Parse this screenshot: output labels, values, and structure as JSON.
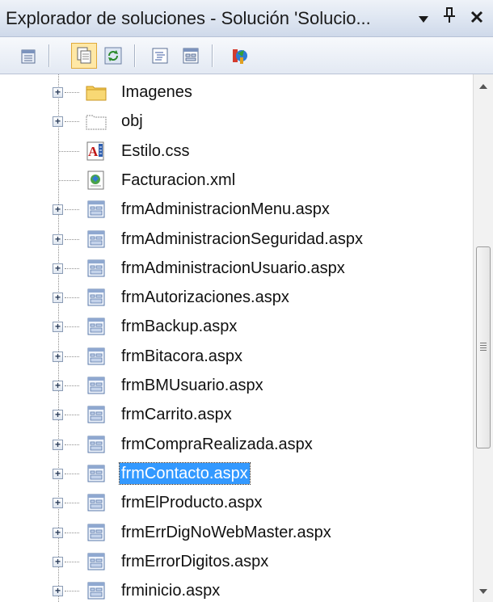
{
  "window": {
    "title": "Explorador de soluciones - Solución 'Solucio...",
    "dropdown_glyph": "▾",
    "pin_glyph": "⊥",
    "close_glyph": "✕"
  },
  "toolbar": {
    "buttons": [
      {
        "icon": "properties-icon",
        "active": false
      },
      {
        "icon": "show-all-files-icon",
        "active": true
      },
      {
        "icon": "refresh-icon",
        "active": false
      },
      {
        "icon": "view-code-icon",
        "active": false
      },
      {
        "icon": "view-designer-icon",
        "active": false
      },
      {
        "icon": "copy-website-icon",
        "active": false
      }
    ]
  },
  "tree": {
    "items": [
      {
        "label": "Imagenes",
        "icon": "folder-icon",
        "expandable": true
      },
      {
        "label": "obj",
        "icon": "folder-outline-icon",
        "expandable": true
      },
      {
        "label": "Estilo.css",
        "icon": "css-file-icon",
        "expandable": false
      },
      {
        "label": "Facturacion.xml",
        "icon": "xml-file-icon",
        "expandable": false
      },
      {
        "label": "frmAdministracionMenu.aspx",
        "icon": "aspx-file-icon",
        "expandable": true
      },
      {
        "label": "frmAdministracionSeguridad.aspx",
        "icon": "aspx-file-icon",
        "expandable": true
      },
      {
        "label": "frmAdministracionUsuario.aspx",
        "icon": "aspx-file-icon",
        "expandable": true
      },
      {
        "label": "frmAutorizaciones.aspx",
        "icon": "aspx-file-icon",
        "expandable": true
      },
      {
        "label": "frmBackup.aspx",
        "icon": "aspx-file-icon",
        "expandable": true
      },
      {
        "label": "frmBitacora.aspx",
        "icon": "aspx-file-icon",
        "expandable": true
      },
      {
        "label": "frmBMUsuario.aspx",
        "icon": "aspx-file-icon",
        "expandable": true
      },
      {
        "label": "frmCarrito.aspx",
        "icon": "aspx-file-icon",
        "expandable": true
      },
      {
        "label": "frmCompraRealizada.aspx",
        "icon": "aspx-file-icon",
        "expandable": true
      },
      {
        "label": "frmContacto.aspx",
        "icon": "aspx-file-icon",
        "expandable": true,
        "selected": true
      },
      {
        "label": "frmElProducto.aspx",
        "icon": "aspx-file-icon",
        "expandable": true
      },
      {
        "label": "frmErrDigNoWebMaster.aspx",
        "icon": "aspx-file-icon",
        "expandable": true
      },
      {
        "label": "frmErrorDigitos.aspx",
        "icon": "aspx-file-icon",
        "expandable": true
      },
      {
        "label": "frminicio.aspx",
        "icon": "aspx-file-icon",
        "expandable": true
      }
    ]
  },
  "scrollbar": {
    "up_glyph": "▲",
    "down_glyph": "▼",
    "position_fraction": 0.45
  },
  "colors": {
    "selection": "#3399ff",
    "title_bg": "#dde5f1"
  }
}
